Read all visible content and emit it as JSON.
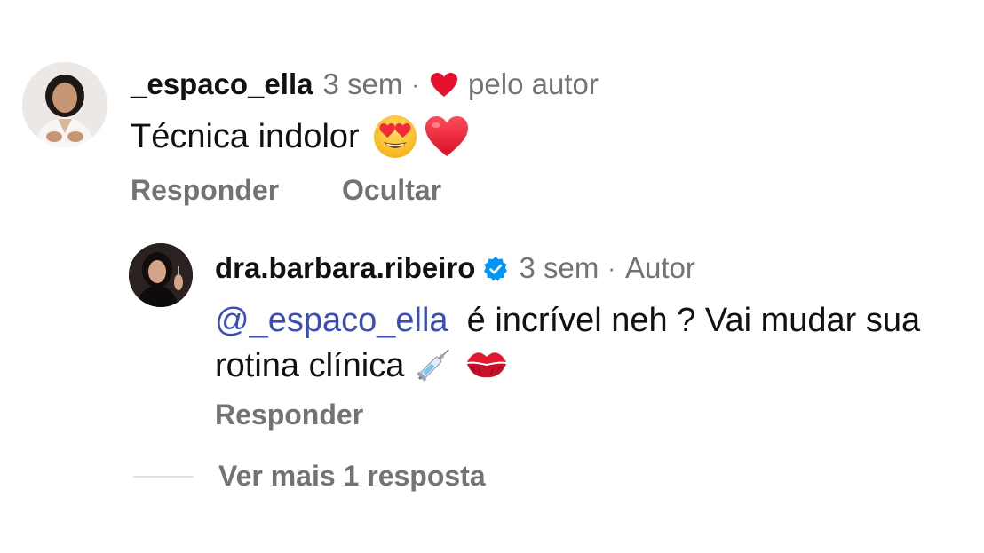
{
  "comment": {
    "username": "_espaco_ella",
    "time": "3 sem",
    "separator": "·",
    "liked_by_author_label": "pelo autor",
    "text": "Técnica indolor",
    "actions": {
      "reply_label": "Responder",
      "hide_label": "Ocultar"
    }
  },
  "reply": {
    "username": "dra.barbara.ribeiro",
    "verified": true,
    "time": "3 sem",
    "separator": "·",
    "author_badge": "Autor",
    "mention": "@_espaco_ella",
    "text": " é incrível neh ? Vai mudar sua rotina clínica",
    "actions": {
      "reply_label": "Responder"
    }
  },
  "view_more": {
    "label": "Ver mais 1 resposta"
  },
  "colors": {
    "muted_text": "#737373",
    "mention": "#3a4fb5",
    "heart": "#e8112d",
    "verified": "#0095f6"
  },
  "icons": {
    "liked_by_author": "heart-icon",
    "verified": "verified-badge-icon",
    "emojis_comment": [
      "heart-eyes-emoji",
      "red-heart-emoji"
    ],
    "emojis_reply": [
      "syringe-emoji",
      "kiss-mark-emoji"
    ]
  }
}
